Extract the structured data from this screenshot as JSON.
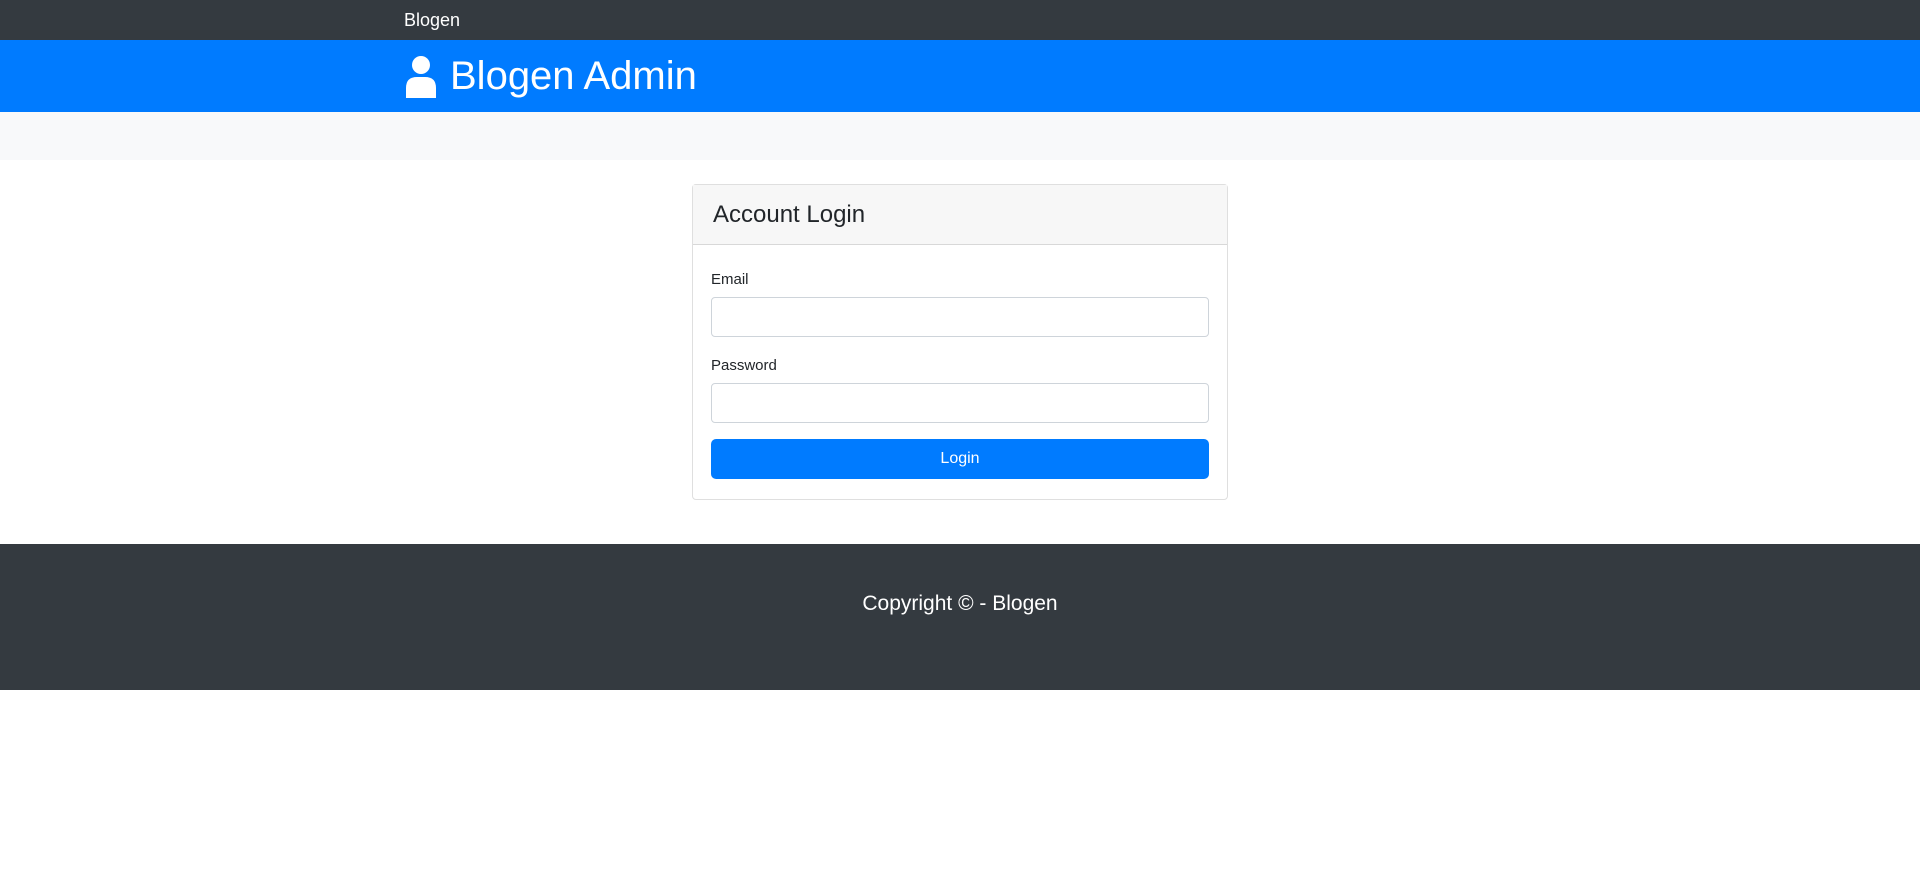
{
  "topnav": {
    "brand": "Blogen"
  },
  "header": {
    "title": "Blogen Admin",
    "icon": "user-icon"
  },
  "login_card": {
    "title": "Account Login",
    "email_label": "Email",
    "email_value": "",
    "password_label": "Password",
    "password_value": "",
    "submit_label": "Login"
  },
  "footer": {
    "copyright": "Copyright © - Blogen"
  },
  "colors": {
    "primary": "#007bff",
    "dark": "#343a40",
    "light": "#f8f9fa"
  }
}
